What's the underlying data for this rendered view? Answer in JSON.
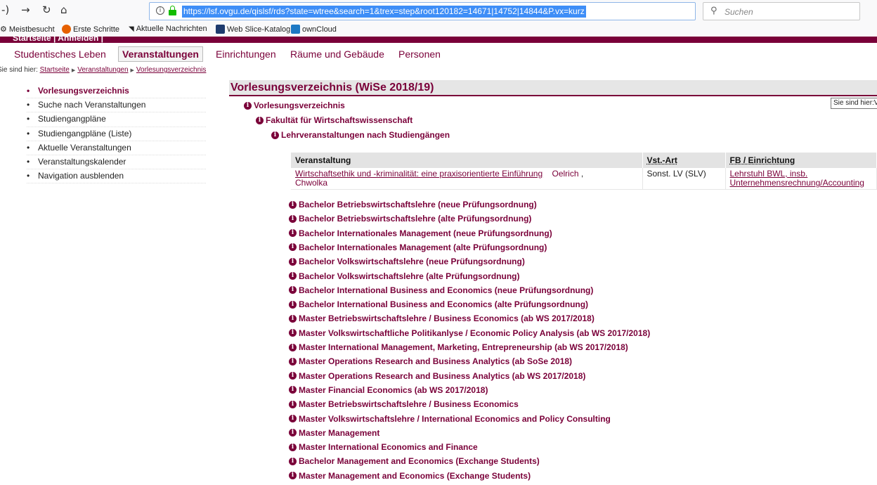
{
  "browser": {
    "url": "https://lsf.ovgu.de/qislsf/rds?state=wtree&search=1&trex=step&root120182=14671|14752|14844&P.vx=kurz",
    "search_placeholder": "Suchen",
    "bookmarks": [
      "Meistbesucht",
      "Erste Schritte",
      "Aktuelle Nachrichten",
      "Web Slice-Katalog",
      "ownCloud"
    ]
  },
  "site": {
    "top_links": "Startseite | Anmelden |",
    "nav_tabs": [
      "Studentisches Leben",
      "Veranstaltungen",
      "Einrichtungen",
      "Räume und Gebäude",
      "Personen"
    ],
    "breadcrumb": {
      "prefix": "Sie sind hier:",
      "items": [
        "Startseite",
        "Veranstaltungen",
        "Vorlesungsverzeichnis"
      ]
    }
  },
  "sidebar": {
    "items": [
      "Vorlesungsverzeichnis",
      "Suche nach Veranstaltungen",
      "Studiengangpläne",
      "Studiengangpläne (Liste)",
      "Aktuelle Veranstaltungen",
      "Veranstaltungskalender",
      "Navigation ausblenden"
    ]
  },
  "main": {
    "title": "Vorlesungsverzeichnis (WiSe 2018/19)",
    "tooltip": "Sie sind hier:V",
    "tree": [
      "Vorlesungsverzeichnis",
      "Fakultät für Wirtschaftswissenschaft",
      "Lehrveranstaltungen nach Studiengängen"
    ],
    "table": {
      "headers": [
        "Veranstaltung",
        "Vst.-Art",
        "FB / Einrichtung"
      ],
      "row": {
        "course": "Wirtschaftsethik und -kriminalität: eine praxisorientierte Einführung",
        "lecturer1": "Oelrich",
        "lecturer2": "Chwolka",
        "type": "Sonst. LV (SLV)",
        "dept_line1": "Lehrstuhl BWL, insb.",
        "dept_line2": "Unternehmensrechnung/Accounting"
      }
    },
    "programs": [
      "Bachelor Betriebswirtschaftslehre (neue Prüfungsordnung)",
      "Bachelor Betriebswirtschaftslehre (alte Prüfungsordnung)",
      "Bachelor Internationales Management (neue Prüfungsordnung)",
      "Bachelor Internationales Management (alte Prüfungsordnung)",
      "Bachelor Volkswirtschaftslehre (neue Prüfungsordnung)",
      "Bachelor Volkswirtschaftslehre (alte Prüfungsordnung)",
      "Bachelor International Business and Economics (neue Prüfungsordnung)",
      "Bachelor International Business and Economics (alte Prüfungsordnung)",
      "Master Betriebswirtschaftslehre / Business Economics (ab WS 2017/2018)",
      "Master Volkswirtschaftliche Politikanlyse / Economic Policy Analysis (ab WS 2017/2018)",
      "Master International Management, Marketing, Entrepreneurship (ab WS 2017/2018)",
      "Master Operations Research and Business Analytics (ab SoSe 2018)",
      "Master Operations Research and Business Analytics (ab WS 2017/2018)",
      "Master Financial Economics (ab WS 2017/2018)",
      "Master Betriebswirtschaftslehre / Business Economics",
      "Master Volkswirtschaftslehre / International Economics and Policy Consulting",
      "Master Management",
      "Master International Economics and Finance",
      "Bachelor Management and Economics (Exchange Students)",
      "Master Management and Economics (Exchange Students)"
    ]
  },
  "colors": {
    "brand": "#7a0039",
    "url_highlight": "#3e8ef7"
  }
}
